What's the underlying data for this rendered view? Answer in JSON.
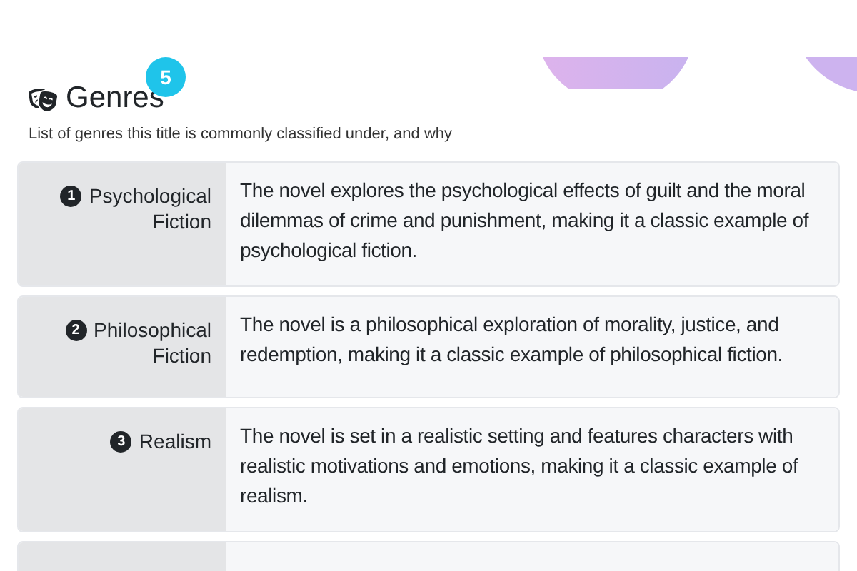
{
  "header": {
    "title": "Genres",
    "count": "5",
    "subtitle": "List of genres this title is commonly classified under, and why"
  },
  "genres": [
    {
      "number": "1",
      "name": "Psychological Fiction",
      "reason": "The novel explores the psychological effects of guilt and the moral dilemmas of crime and punishment, making it a classic example of psychological fiction."
    },
    {
      "number": "2",
      "name": "Philosophical Fiction",
      "reason": "The novel is a philosophical exploration of morality, justice, and redemption, making it a classic example of philosophical fiction."
    },
    {
      "number": "3",
      "name": "Realism",
      "reason": "The novel is set in a realistic setting and features characters with realistic motivations and emotions, making it a classic example of realism."
    }
  ]
}
